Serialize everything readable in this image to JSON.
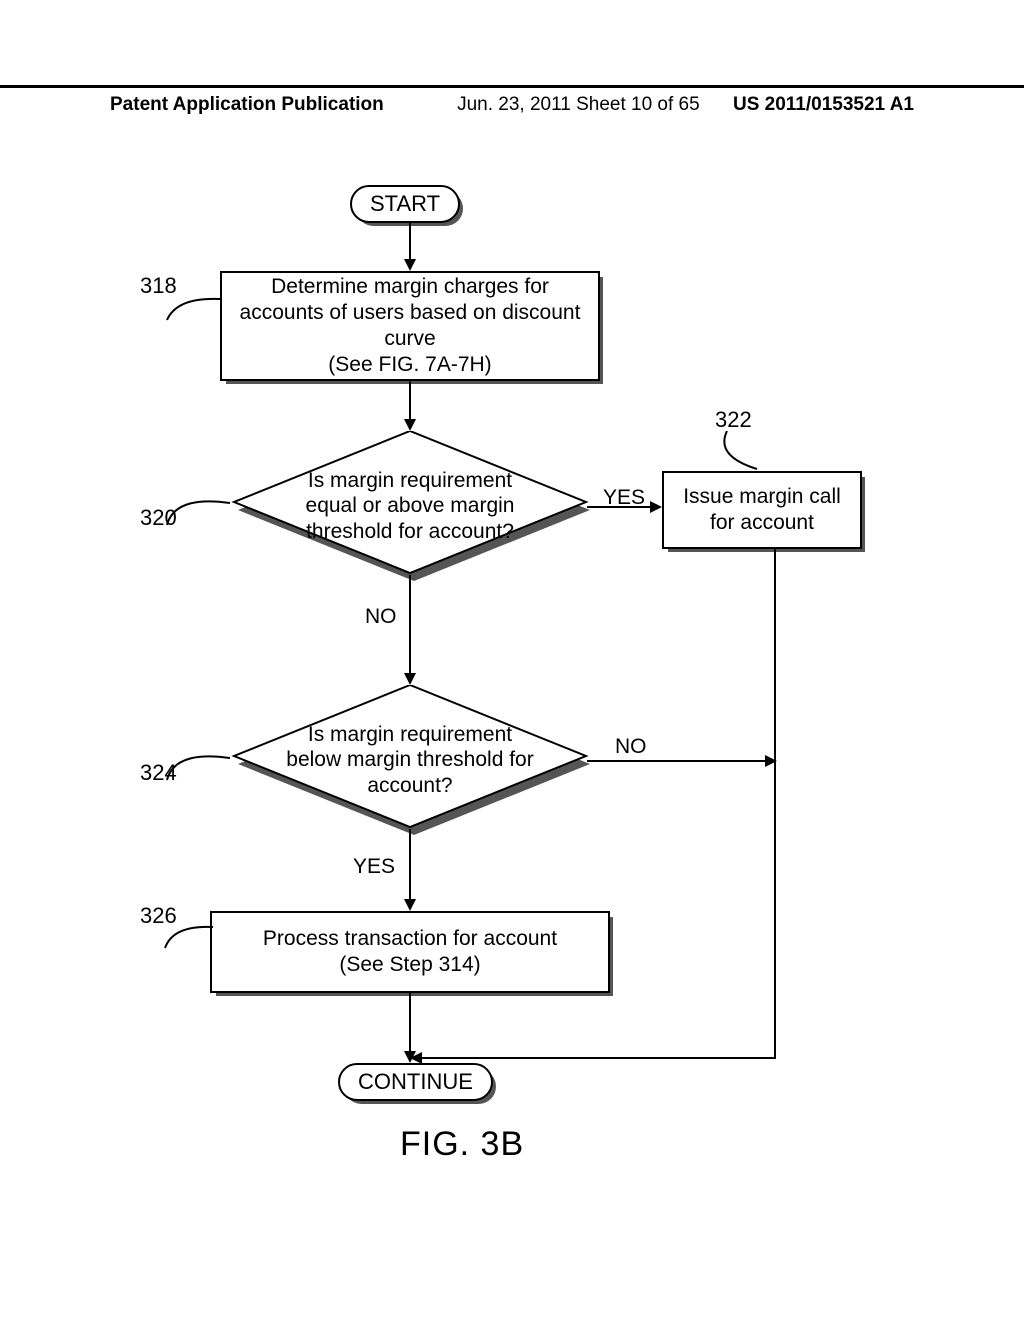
{
  "header": {
    "left": "Patent Application Publication",
    "mid": "Jun. 23, 2011  Sheet 10 of 65",
    "right": "US 2011/0153521 A1"
  },
  "flow": {
    "start": "START",
    "box318": "Determine margin charges for accounts of users based on discount curve\n(See FIG. 7A-7H)",
    "dec320": "Is margin requirement equal or above margin threshold for account?",
    "box322": "Issue margin call for account",
    "dec324": "Is margin requirement below margin threshold for account?",
    "box326": "Process transaction for account\n(See Step 314)",
    "continue": "CONTINUE",
    "yes": "YES",
    "no": "NO"
  },
  "refs": {
    "r318": "318",
    "r320": "320",
    "r322": "322",
    "r324": "324",
    "r326": "326"
  },
  "figure_label": "FIG.  3B",
  "chart_data": {
    "type": "flowchart",
    "nodes": [
      {
        "id": "start",
        "kind": "terminator",
        "text": "START"
      },
      {
        "id": "318",
        "kind": "process",
        "text": "Determine margin charges for accounts of users based on discount curve (See FIG. 7A-7H)"
      },
      {
        "id": "320",
        "kind": "decision",
        "text": "Is margin requirement equal or above margin threshold for account?"
      },
      {
        "id": "322",
        "kind": "process",
        "text": "Issue margin call for account"
      },
      {
        "id": "324",
        "kind": "decision",
        "text": "Is margin requirement below margin threshold for account?"
      },
      {
        "id": "326",
        "kind": "process",
        "text": "Process transaction for account (See Step 314)"
      },
      {
        "id": "continue",
        "kind": "terminator",
        "text": "CONTINUE"
      }
    ],
    "edges": [
      {
        "from": "start",
        "to": "318",
        "label": ""
      },
      {
        "from": "318",
        "to": "320",
        "label": ""
      },
      {
        "from": "320",
        "to": "322",
        "label": "YES"
      },
      {
        "from": "320",
        "to": "324",
        "label": "NO"
      },
      {
        "from": "322",
        "to": "continue",
        "label": ""
      },
      {
        "from": "324",
        "to": "326",
        "label": "YES"
      },
      {
        "from": "324",
        "to": "continue",
        "label": "NO"
      },
      {
        "from": "326",
        "to": "continue",
        "label": ""
      }
    ]
  }
}
